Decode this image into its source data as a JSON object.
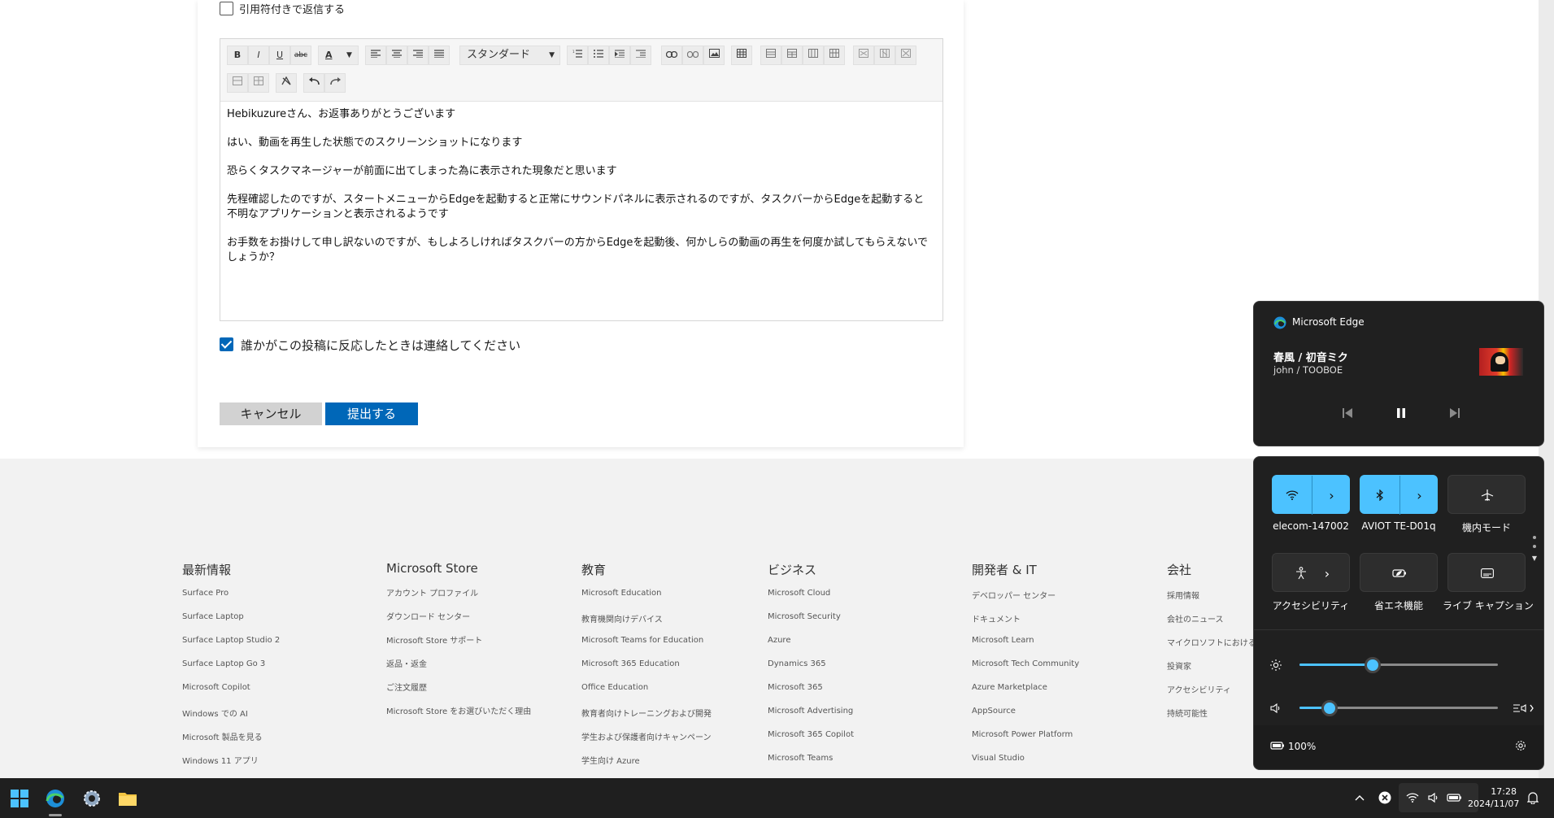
{
  "form": {
    "quote_reply_label": "引用符付きで返信する",
    "quote_reply_checked": false,
    "toolbar": {
      "bold": "B",
      "italic": "I",
      "underline": "U",
      "strike": "abc",
      "font_color": "A",
      "paragraph_style": "スタンダード"
    },
    "body": [
      "Hebikuzureさん、お返事ありがとうございます",
      "はい、動画を再生した状態でのスクリーンショットになります",
      "恐らくタスクマネージャーが前面に出てしまった為に表示された現象だと思います",
      "先程確認したのですが、スタートメニューからEdgeを起動すると正常にサウンドパネルに表示されるのですが、タスクバーからEdgeを起動すると不明なアプリケーションと表示されるようです",
      "お手数をお掛けして申し訳ないのですが、もしよろしければタスクバーの方からEdgeを起動後、何かしらの動画の再生を何度か試してもらえないでしょうか？"
    ],
    "notify_label": "誰かがこの投稿に反応したときは連絡してください",
    "notify_checked": true,
    "cancel_label": "キャンセル",
    "submit_label": "提出する"
  },
  "footer": {
    "columns": [
      {
        "title": "最新情報",
        "links": [
          "Surface Pro",
          "Surface Laptop",
          "Surface Laptop Studio 2",
          "Surface Laptop Go 3",
          "Microsoft Copilot",
          "Windows での AI",
          "Microsoft 製品を見る",
          "Windows 11 アプリ"
        ]
      },
      {
        "title": "Microsoft Store",
        "links": [
          "アカウント プロファイル",
          "ダウンロード センター",
          "Microsoft Store サポート",
          "返品・返金",
          "ご注文履歴",
          "Microsoft Store をお選びいただく理由"
        ]
      },
      {
        "title": "教育",
        "links": [
          "Microsoft Education",
          "教育機関向けデバイス",
          "Microsoft Teams for Education",
          "Microsoft 365 Education",
          "Office Education",
          "教育者向けトレーニングおよび開発",
          "学生および保護者向けキャンペーン",
          "学生向け Azure"
        ]
      },
      {
        "title": "ビジネス",
        "links": [
          "Microsoft Cloud",
          "Microsoft Security",
          "Azure",
          "Dynamics 365",
          "Microsoft 365",
          "Microsoft Advertising",
          "Microsoft 365 Copilot",
          "Microsoft Teams"
        ]
      },
      {
        "title": "開発者 & IT",
        "links": [
          "デベロッパー センター",
          "ドキュメント",
          "Microsoft Learn",
          "Microsoft Tech Community",
          "Azure Marketplace",
          "AppSource",
          "Microsoft Power Platform",
          "Visual Studio"
        ]
      },
      {
        "title": "会社",
        "links": [
          "採用情報",
          "会社のニュース",
          "マイクロソフトにおけるプライ",
          "投資家",
          "アクセシビリティ",
          "持続可能性"
        ]
      }
    ]
  },
  "media": {
    "app_name": "Microsoft Edge",
    "track_title": "春風 / 初音ミク",
    "artist": "john / TOOBOE"
  },
  "quick_settings": {
    "tiles": [
      {
        "label": "elecom-147002",
        "icon": "wifi-icon",
        "on": true,
        "chevron": true
      },
      {
        "label": "AVIOT TE-D01q",
        "icon": "bluetooth-icon",
        "on": true,
        "chevron": true
      },
      {
        "label": "機内モード",
        "icon": "airplane-icon",
        "on": false,
        "chevron": false
      },
      {
        "label": "アクセシビリティ",
        "icon": "accessibility-icon",
        "on": false,
        "chevron": true
      },
      {
        "label": "省エネ機能",
        "icon": "energy-saver-icon",
        "on": false,
        "chevron": false
      },
      {
        "label": "ライブ キャプション",
        "icon": "live-caption-icon",
        "on": false,
        "chevron": false
      }
    ],
    "brightness": 0.37,
    "volume": 0.15,
    "battery": "100%"
  },
  "taskbar": {
    "time": "17:28",
    "date": "2024/11/07"
  },
  "colors": {
    "accent": "#0067b8",
    "quick_on": "#4cc2ff",
    "panel_bg": "#202020"
  }
}
